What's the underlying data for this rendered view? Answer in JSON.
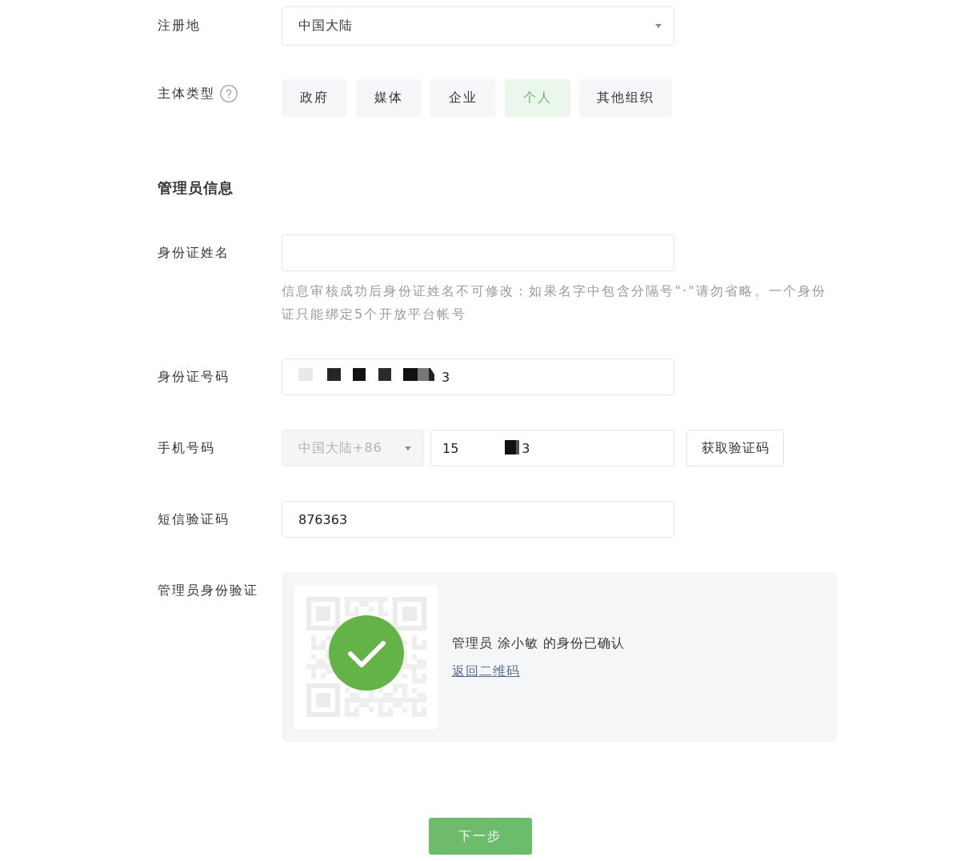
{
  "registration_place": {
    "label": "注册地",
    "value": "中国大陆"
  },
  "entity_type": {
    "label": "主体类型",
    "options": [
      {
        "label": "政府",
        "selected": false
      },
      {
        "label": "媒体",
        "selected": false
      },
      {
        "label": "企业",
        "selected": false
      },
      {
        "label": "个人",
        "selected": true
      },
      {
        "label": "其他组织",
        "selected": false
      }
    ]
  },
  "admin_info": {
    "title": "管理员信息"
  },
  "id_name": {
    "label": "身份证姓名",
    "hint": "信息审核成功后身份证姓名不可修改：如果名字中包含分隔号\"·\"请勿省略。一个身份证只能绑定5个开放平台帐号"
  },
  "id_number": {
    "label": "身份证号码",
    "value": "3"
  },
  "phone": {
    "label": "手机号码",
    "country": {
      "value": "中国大陆+86",
      "disabled": true
    },
    "value_parts": [
      "15",
      "3"
    ],
    "button": "获取验证码"
  },
  "sms_code": {
    "label": "短信验证码",
    "value": "876363"
  },
  "admin_verification": {
    "label": "管理员身份验证",
    "verified": true,
    "message": "管理员 涂小敏 的身份已确认",
    "link": "返回二维码"
  },
  "next_button": {
    "label": "下一步"
  }
}
